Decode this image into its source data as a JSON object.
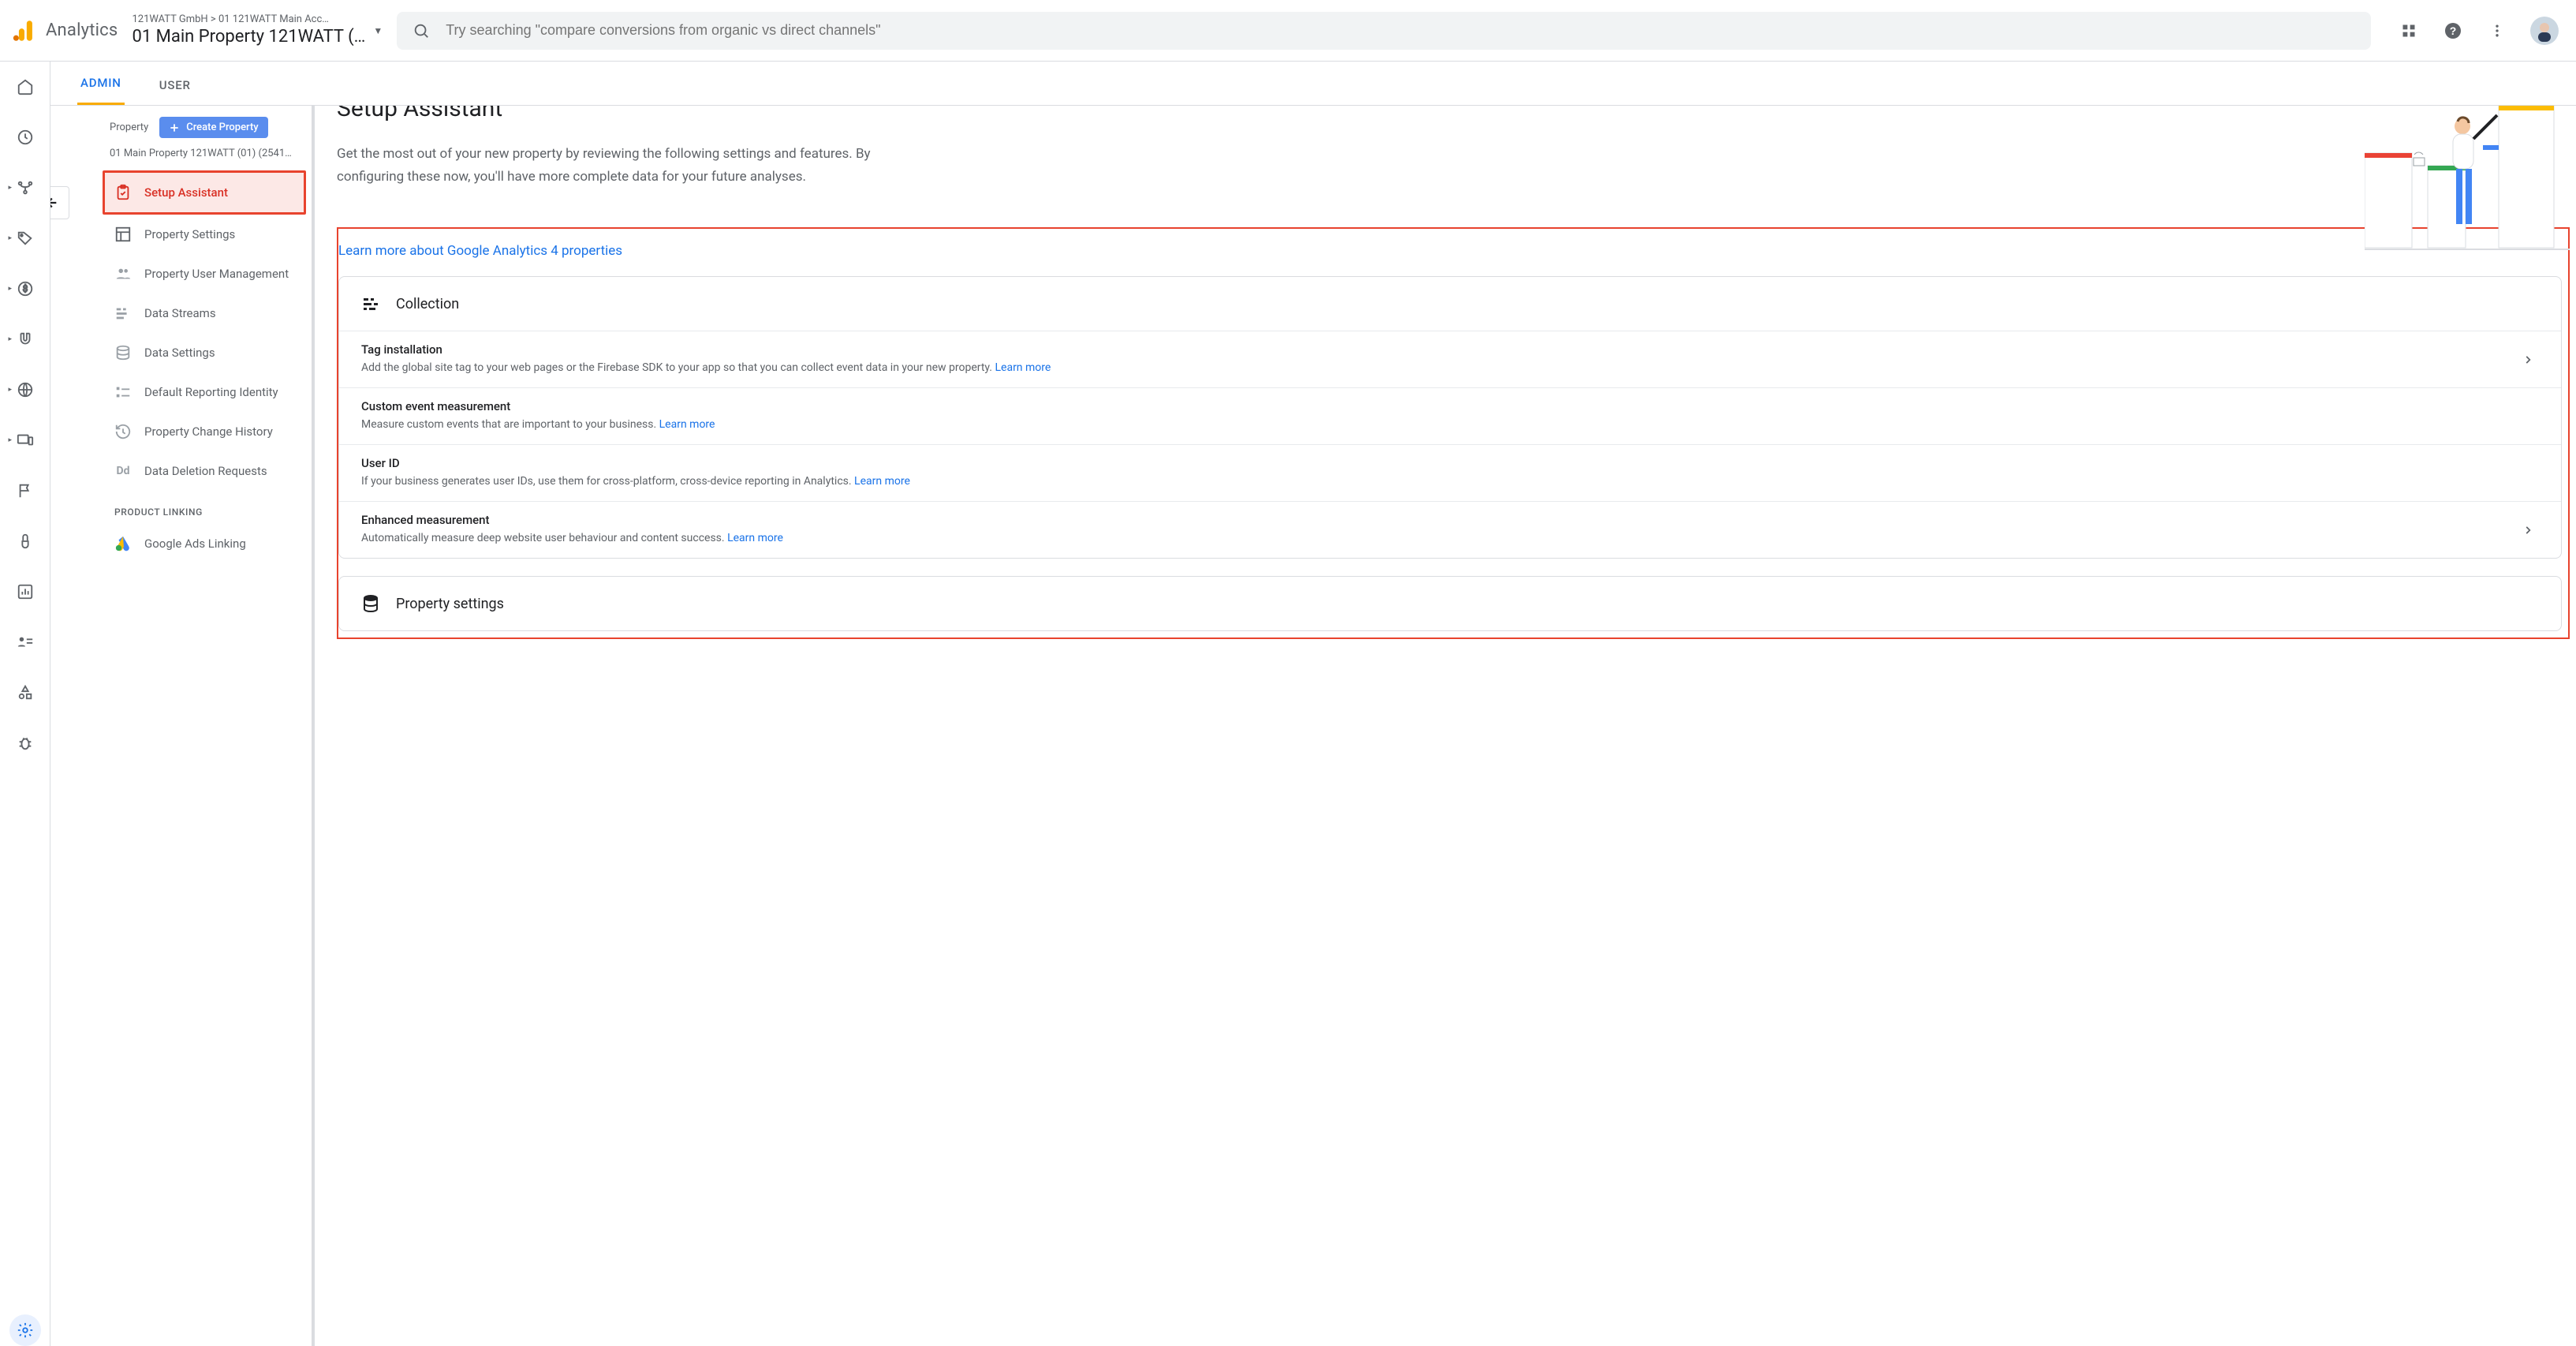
{
  "header": {
    "brand": "Analytics",
    "breadcrumb": "121WATT GmbH > 01 121WATT Main Acc…",
    "property_name": "01 Main Property 121WATT (…",
    "search_placeholder": "Try searching \"compare conversions from organic vs direct channels\""
  },
  "tabs": {
    "admin": "ADMIN",
    "user": "USER"
  },
  "prop_nav": {
    "header_label": "Property",
    "create_label": "Create Property",
    "property_id_line": "01 Main Property 121WATT (01) (2541…",
    "items": [
      {
        "label": "Setup Assistant"
      },
      {
        "label": "Property Settings"
      },
      {
        "label": "Property User Management"
      },
      {
        "label": "Data Streams"
      },
      {
        "label": "Data Settings"
      },
      {
        "label": "Default Reporting Identity"
      },
      {
        "label": "Property Change History"
      },
      {
        "label": "Data Deletion Requests"
      }
    ],
    "section_label": "PRODUCT LINKING",
    "product_links": [
      {
        "label": "Google Ads Linking"
      }
    ]
  },
  "main": {
    "title": "Setup Assistant",
    "desc": "Get the most out of your new property by reviewing the following settings and features. By configuring these now, you'll have more complete data for your future analyses.",
    "learn_more_link": "Learn more about Google Analytics 4 properties",
    "sections": [
      {
        "title": "Collection",
        "rows": [
          {
            "title": "Tag installation",
            "desc": "Add the global site tag to your web pages or the Firebase SDK to your app so that you can collect event data in your new property.",
            "learn": "Learn more",
            "chevron": true
          },
          {
            "title": "Custom event measurement",
            "desc": "Measure custom events that are important to your business.",
            "learn": "Learn more",
            "chevron": false
          },
          {
            "title": "User ID",
            "desc": "If your business generates user IDs, use them for cross-platform, cross-device reporting in Analytics.",
            "learn": "Learn more",
            "chevron": false
          },
          {
            "title": "Enhanced measurement",
            "desc": "Automatically measure deep website user behaviour and content success.",
            "learn": "Learn more",
            "chevron": true
          }
        ]
      },
      {
        "title": "Property settings",
        "rows": []
      }
    ]
  }
}
